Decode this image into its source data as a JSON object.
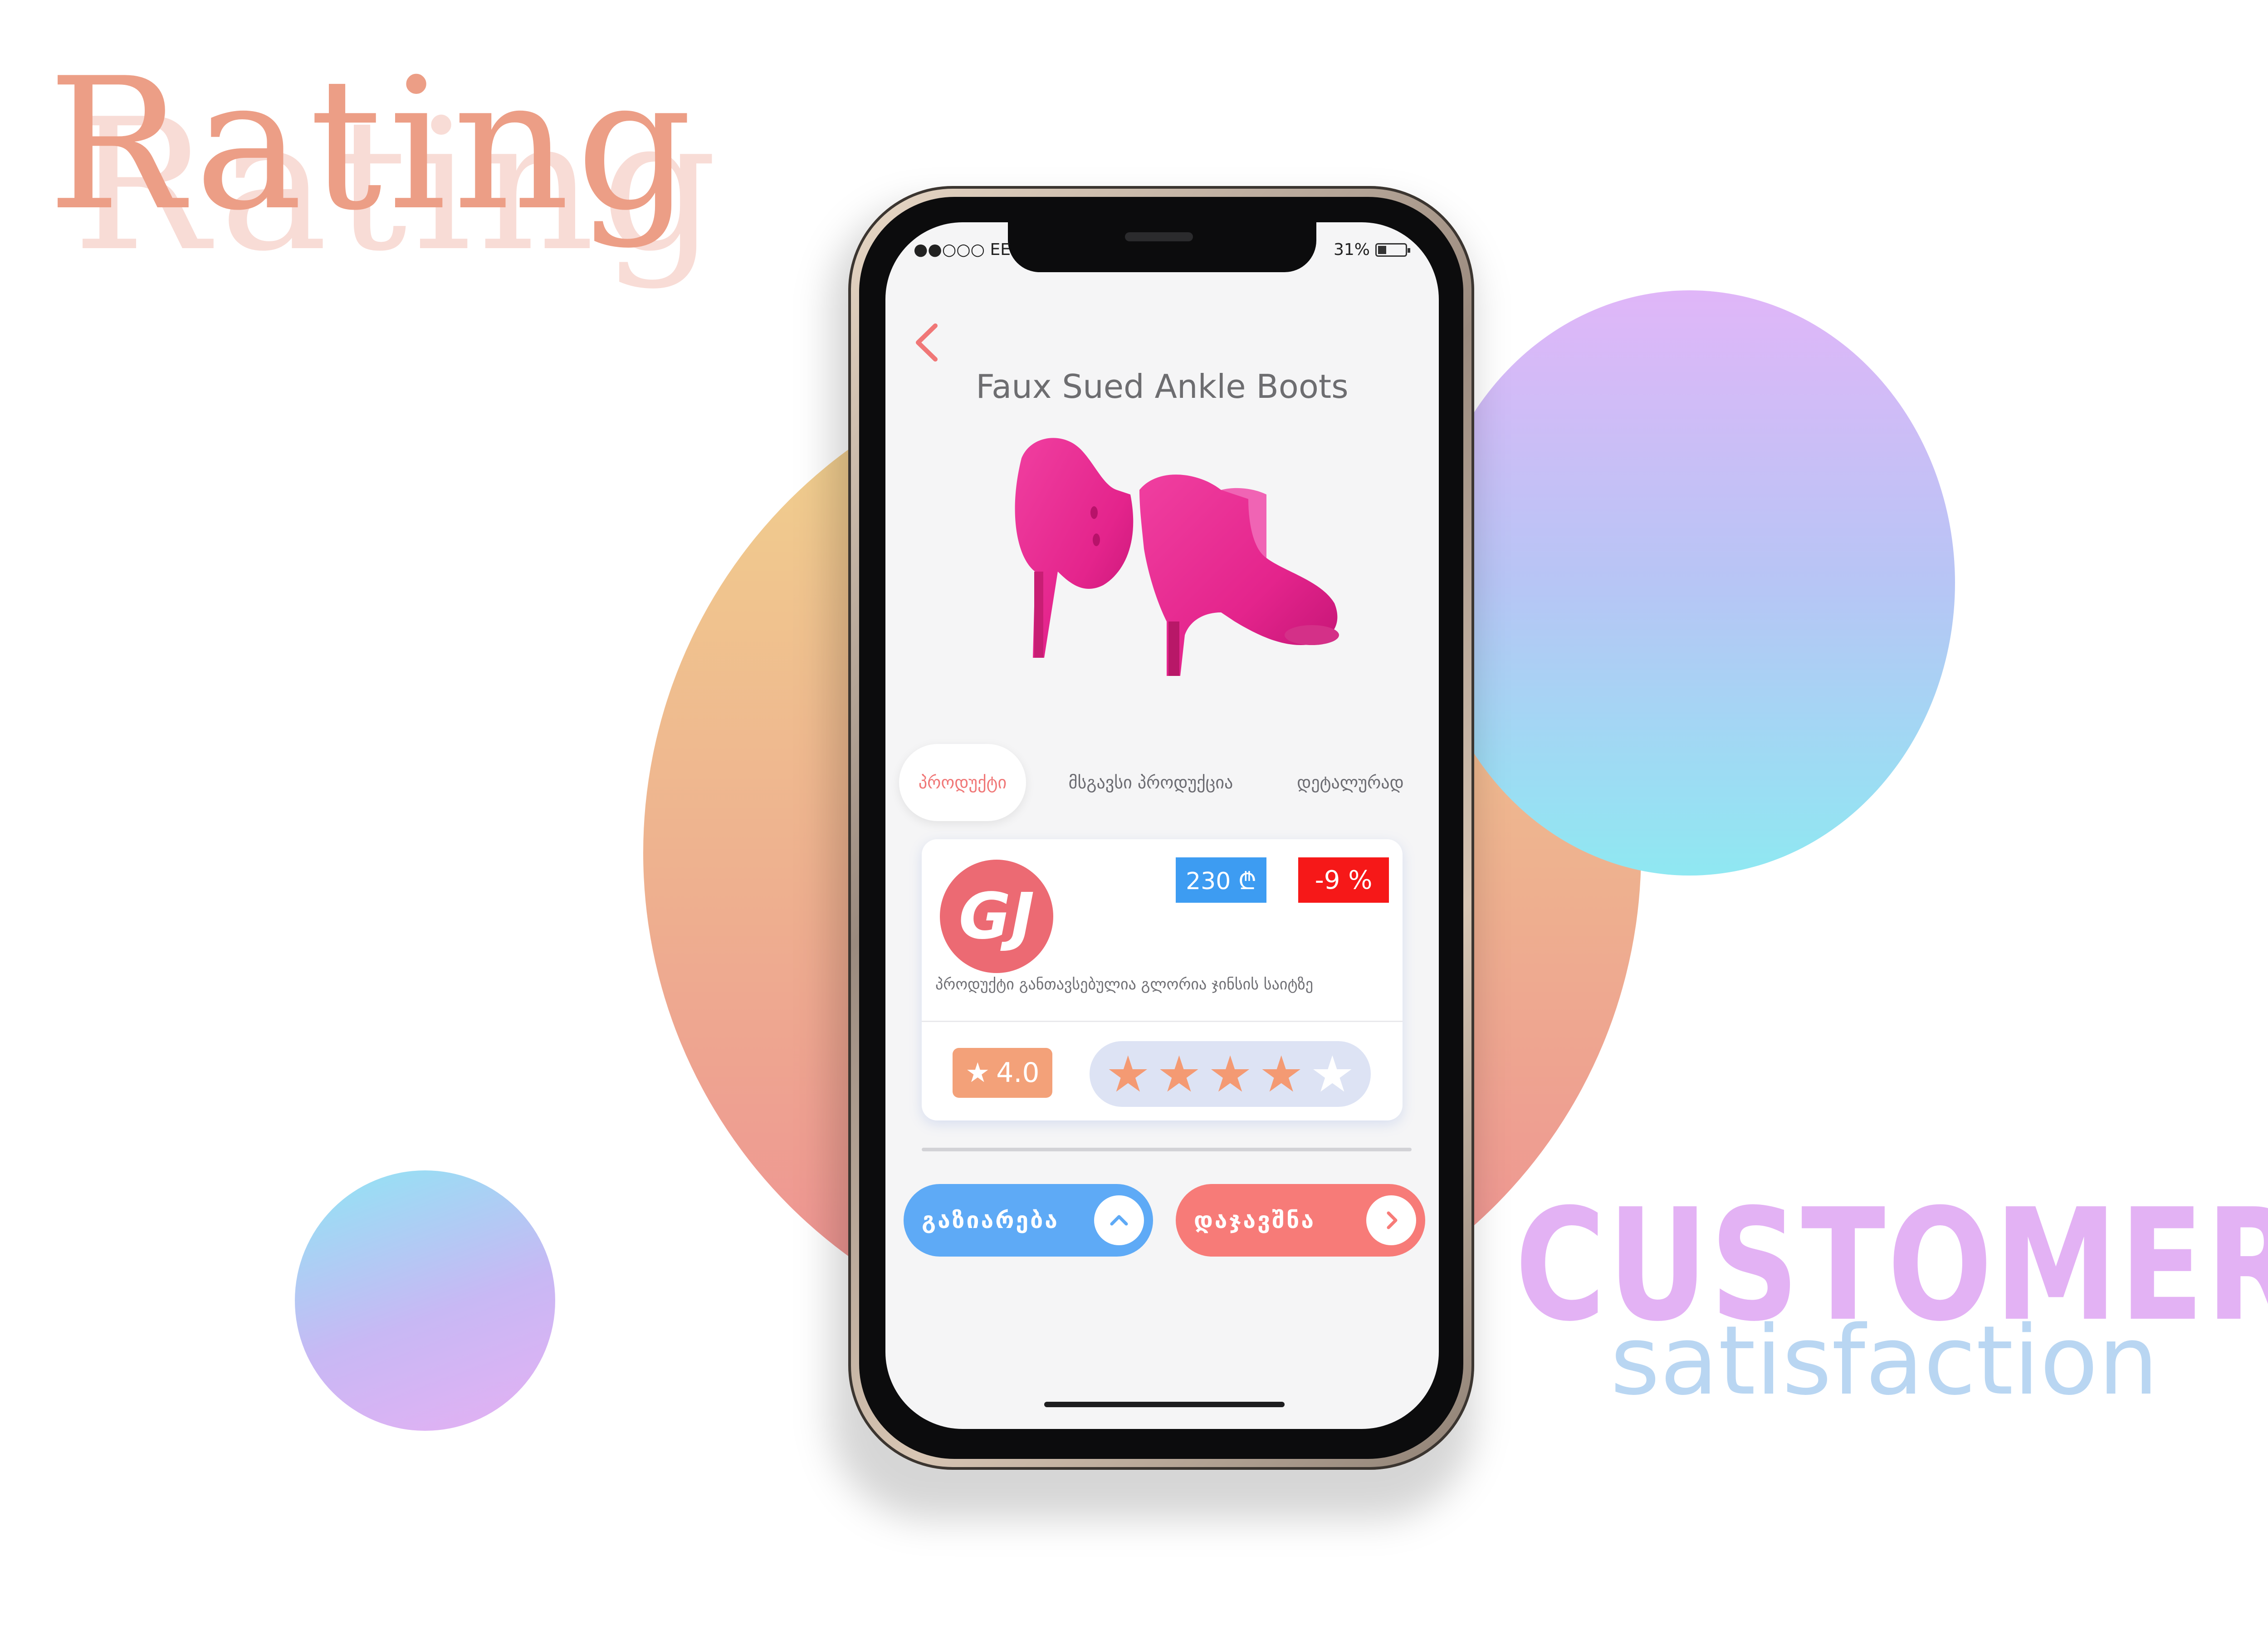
{
  "poster": {
    "title": "Rating",
    "tag_main": "CUSTOMER",
    "tag_sub": "satisfaction"
  },
  "status_bar": {
    "carrier": "●●○○○ EE",
    "battery": "31%",
    "battery_level": 0.31
  },
  "product": {
    "title": "Faux Sued Ankle Boots",
    "image_icon": "pink-ankle-boots-image"
  },
  "tabs": [
    {
      "label": "პროდუქტი",
      "active": true
    },
    {
      "label": "მსგავსი პროდუქცია",
      "active": false
    },
    {
      "label": "დეტალურად",
      "active": false
    }
  ],
  "card": {
    "logo_text": "GJ",
    "price": "230 ₾",
    "discount": "-9 %",
    "description": "პროდუქტი განთავსებულია გლორია ჯინსის საიტზე",
    "rating_value": "4.0",
    "stars_filled": 4,
    "stars_total": 5
  },
  "actions": {
    "share_label": "გაზიარება",
    "download_label": "დაჯავშნა"
  },
  "colors": {
    "accent_red": "#f07777",
    "price_blue": "#3d9cf2",
    "discount_red": "#f61818",
    "star": "#f49a73"
  }
}
